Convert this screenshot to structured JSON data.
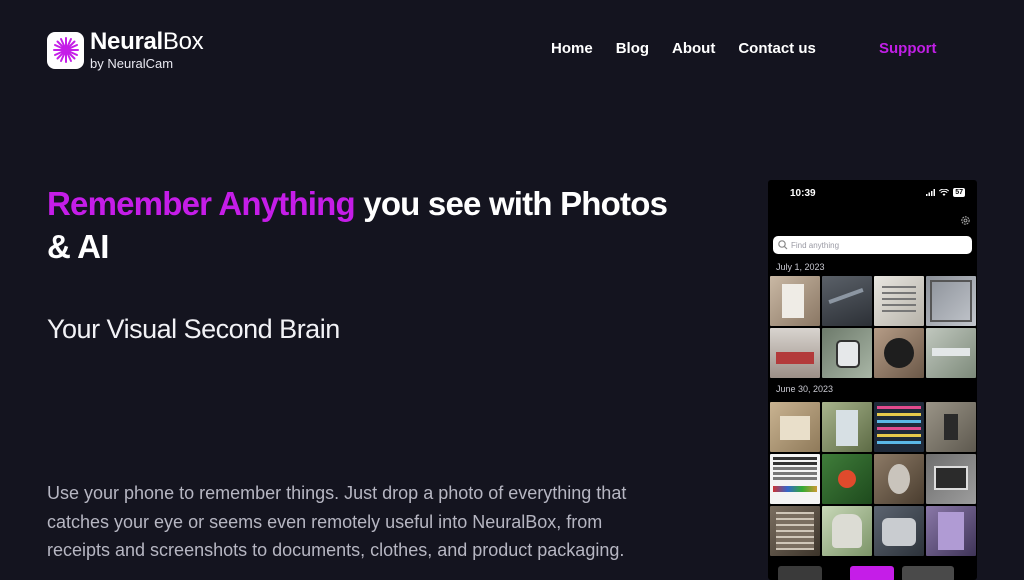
{
  "header": {
    "logo_name_bold": "Neural",
    "logo_name_light": "Box",
    "logo_sub": "by NeuralCam",
    "nav": [
      "Home",
      "Blog",
      "About",
      "Contact us"
    ],
    "support": "Support"
  },
  "hero": {
    "headline_accent": "Remember Anything",
    "headline_rest": " you see with Photos & AI",
    "subtitle": "Your Visual Second Brain",
    "description": "Use your phone to remember things. Just drop a photo of everything that catches your eye or seems even remotely useful into NeuralBox, from receipts and screenshots to documents, clothes, and product packaging."
  },
  "phone": {
    "time": "10:39",
    "battery": "57",
    "search_placeholder": "Find anything",
    "sections": [
      {
        "date": "July 1, 2023"
      },
      {
        "date": "June 30, 2023"
      }
    ]
  },
  "colors": {
    "background": "#14141f",
    "accent": "#c51de8",
    "support": "#c11fe6"
  },
  "icons": [
    "neuralbox-logo-icon",
    "signal-icon",
    "wifi-icon",
    "battery-icon",
    "gear-icon",
    "search-icon"
  ]
}
